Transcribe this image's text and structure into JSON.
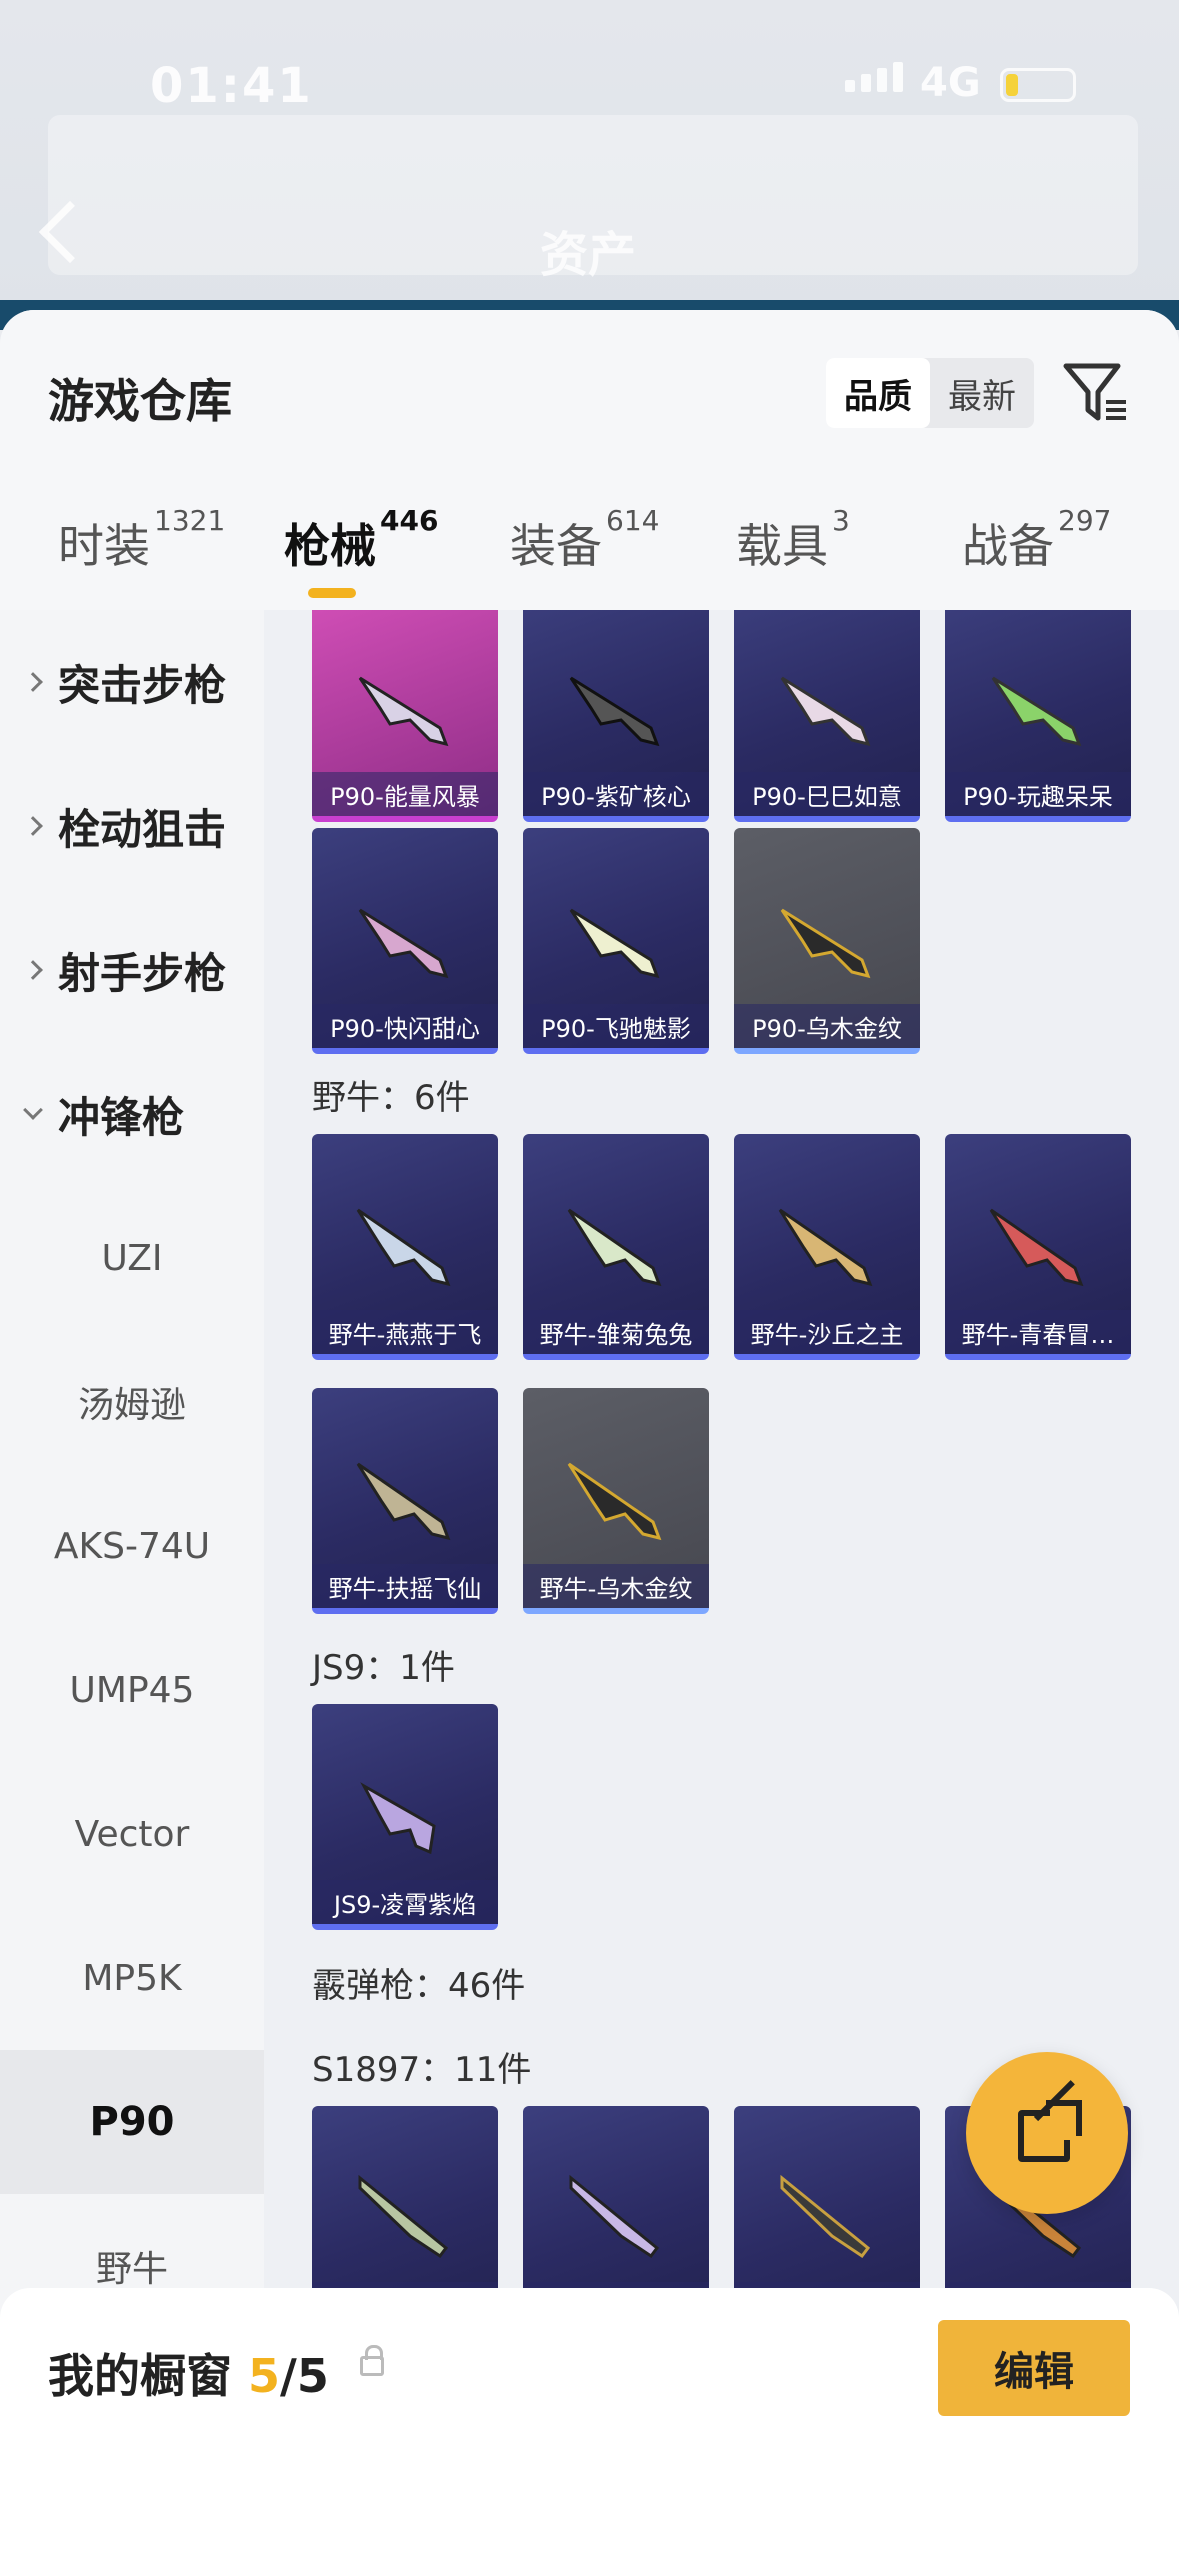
{
  "status": {
    "time": "01:41",
    "network": "4G"
  },
  "header_ghost": {
    "title": "资产"
  },
  "panel": {
    "title": "游戏仓库",
    "sort_options": [
      "品质",
      "最新"
    ],
    "tabs": [
      {
        "label": "时装",
        "count": "1321"
      },
      {
        "label": "枪械",
        "count": "446"
      },
      {
        "label": "装备",
        "count": "614"
      },
      {
        "label": "载具",
        "count": "3"
      },
      {
        "label": "战备",
        "count": "297"
      }
    ]
  },
  "sidebar": {
    "categories": [
      "突击步枪",
      "栓动狙击",
      "射手步枪",
      "冲锋枪"
    ],
    "subs": [
      "UZI",
      "汤姆逊",
      "AKS-74U",
      "UMP45",
      "Vector",
      "MP5K",
      "P90",
      "野牛"
    ]
  },
  "p90_items": [
    "P90-能量风暴",
    "P90-紫矿核心",
    "P90-巳巳如意",
    "P90-玩趣呆呆",
    "P90-快闪甜心",
    "P90-飞驰魅影",
    "P90-乌木金纹"
  ],
  "groups": {
    "bison": "野牛：6件",
    "js9": "JS9：1件",
    "shotgun": "霰弹枪：46件",
    "s1897": "S1897：11件"
  },
  "bison_items": [
    "野牛-燕燕于飞",
    "野牛-雏菊兔兔",
    "野牛-沙丘之主",
    "野牛-青春冒…",
    "野牛-扶摇飞仙",
    "野牛-乌木金纹"
  ],
  "js9_items": [
    "JS9-凌霄紫焰"
  ],
  "footer": {
    "title": "我的橱窗",
    "count": "5",
    "total": "/5",
    "edit": "编辑"
  }
}
